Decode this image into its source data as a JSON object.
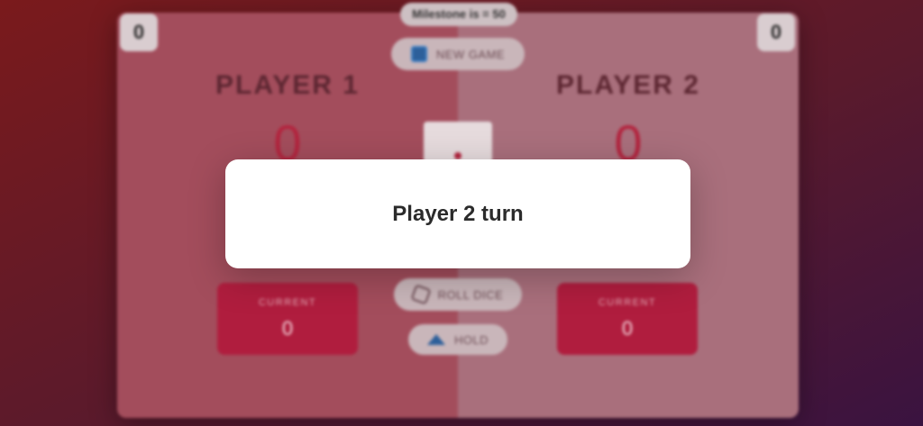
{
  "milestone": "Milestone is = 50",
  "wins": {
    "player1": "0",
    "player2": "0"
  },
  "buttons": {
    "new_game": {
      "label": "NEW GAME",
      "icon": "new-game-icon"
    },
    "roll_dice": {
      "label": "ROLL DICE",
      "icon": "dice-icon"
    },
    "hold": {
      "label": "HOLD",
      "icon": "hold-icon"
    }
  },
  "players": [
    {
      "name": "PLAYER 1",
      "score": "0",
      "current_label": "CURRENT",
      "current": "0"
    },
    {
      "name": "PLAYER 2",
      "score": "0",
      "current_label": "CURRENT",
      "current": "0"
    }
  ],
  "dice": {
    "face": 1
  },
  "modal": {
    "message": "Player 2 turn"
  },
  "colors": {
    "accent": "#b01d3e",
    "score": "#b3243e",
    "background": "#5a1a2c"
  }
}
